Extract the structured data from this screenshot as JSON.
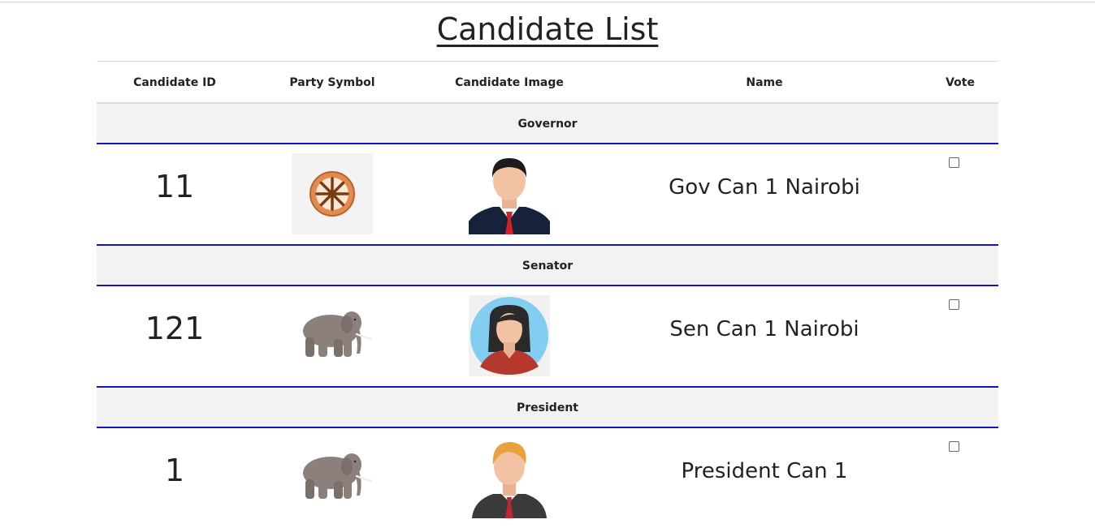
{
  "page": {
    "title": "Candidate List"
  },
  "table": {
    "headers": {
      "candidate_id": "Candidate ID",
      "party_symbol": "Party Symbol",
      "candidate_image": "Candidate Image",
      "name": "Name",
      "vote": "Vote"
    },
    "sections": [
      {
        "position": "Governor",
        "candidate": {
          "id": "11",
          "name": "Gov Can 1 Nairobi",
          "party_symbol": "wheel-icon",
          "image": "male-candidate-avatar",
          "vote_checked": false
        }
      },
      {
        "position": "Senator",
        "candidate": {
          "id": "121",
          "name": "Sen Can 1 Nairobi",
          "party_symbol": "elephant-icon",
          "image": "female-candidate-avatar",
          "vote_checked": false
        }
      },
      {
        "position": "President",
        "candidate": {
          "id": "1",
          "name": "President Can 1",
          "party_symbol": "elephant-icon",
          "image": "male-blonde-candidate-avatar",
          "vote_checked": false
        }
      }
    ]
  },
  "colors": {
    "row_border": "#1313c0",
    "section_bg": "#f2f2f2"
  }
}
